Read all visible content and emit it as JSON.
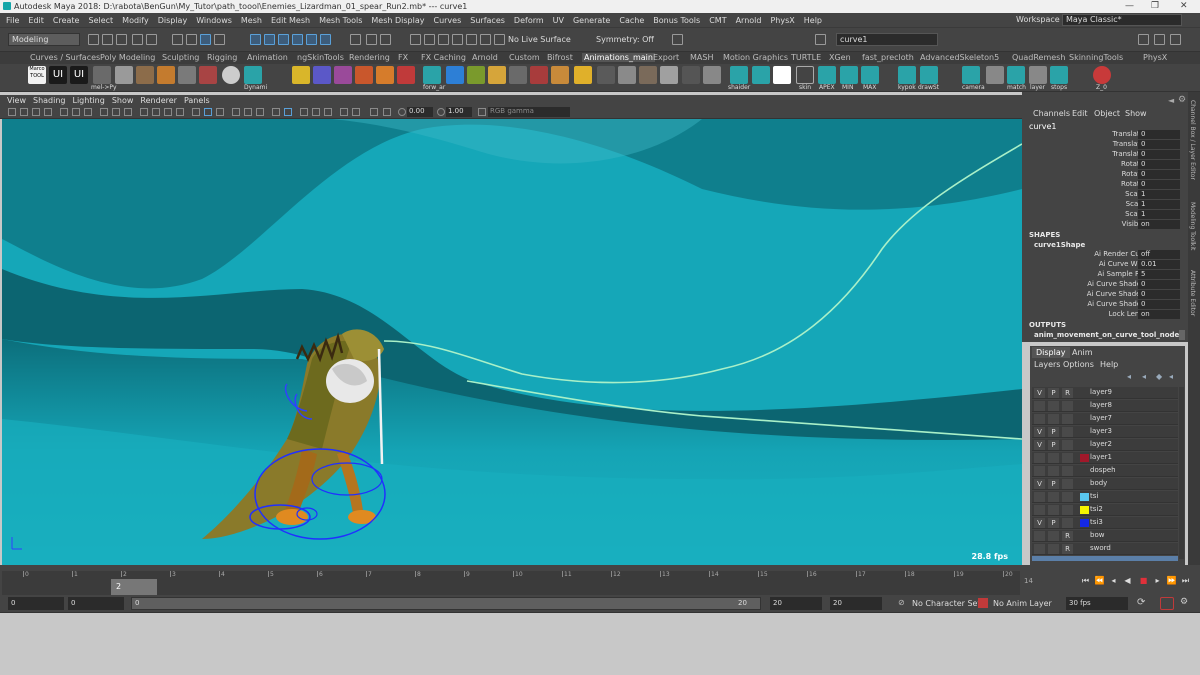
{
  "title_bar": {
    "text": "Autodesk Maya 2018: D:\\rabota\\BenGun\\My_Tutor\\path_toool\\Enemies_Lizardman_01_spear_Run2.mb*   ---   curve1"
  },
  "menu": [
    "File",
    "Edit",
    "Create",
    "Select",
    "Modify",
    "Display",
    "Windows",
    "Mesh",
    "Edit Mesh",
    "Mesh Tools",
    "Mesh Display",
    "Curves",
    "Surfaces",
    "Deform",
    "UV",
    "Generate",
    "Cache",
    "Bonus Tools",
    "CMT",
    "Arnold",
    "PhysX",
    "Help"
  ],
  "workspace": {
    "label": "Workspace :",
    "value": "Maya Classic*"
  },
  "status_line": {
    "mode": "Modeling",
    "live_surface": "No Live Surface",
    "symmetry": "Symmetry: Off",
    "object_name": "curve1"
  },
  "shelf_tabs": [
    "Curves / Surfaces",
    "Poly Modeling",
    "Sculpting",
    "Rigging",
    "Animation",
    "ngSkinTools",
    "Rendering",
    "FX",
    "FX Caching",
    "Arnold",
    "Custom",
    "Bifrost",
    "Animations_main",
    "Export",
    "MASH",
    "Motion Graphics",
    "TURTLE",
    "XGen",
    "fast_precloth",
    "AdvancedSkeleton5",
    "QuadRemesh",
    "SkinningTools",
    "PhysX"
  ],
  "active_shelf_tab": "Animations_main",
  "shelf_labels": {
    "marco": "Marco TOOL",
    "ui1": "UI",
    "ui2": "UI",
    "mel": "mel->Py",
    "dynami": "Dynami",
    "forw": "forw_ar",
    "shaider": "shaider",
    "skin": "skin",
    "apex": "APEX",
    "min": "MIN",
    "max": "MAX",
    "kypok": "kypok",
    "draw": "drawSt",
    "camera": "camera",
    "match": "match",
    "layer": "layer",
    "stops": "stops",
    "z": "Z_0"
  },
  "panel_menu": [
    "View",
    "Shading",
    "Lighting",
    "Show",
    "Renderer",
    "Panels"
  ],
  "panel_toolbar": {
    "exposure": "0.00",
    "gamma": "1.00",
    "colorspace": "RGB gamma"
  },
  "viewport": {
    "fps": "28.8 fps"
  },
  "channel_box": {
    "menu": [
      "Channels",
      "Edit",
      "Object",
      "Show"
    ],
    "object": "curve1",
    "transform": [
      {
        "name": "Translate X",
        "value": "0"
      },
      {
        "name": "Translate Y",
        "value": "0"
      },
      {
        "name": "Translate Z",
        "value": "0"
      },
      {
        "name": "Rotate X",
        "value": "0"
      },
      {
        "name": "Rotate Y",
        "value": "0"
      },
      {
        "name": "Rotate Z",
        "value": "0"
      },
      {
        "name": "Scale X",
        "value": "1"
      },
      {
        "name": "Scale Y",
        "value": "1"
      },
      {
        "name": "Scale Z",
        "value": "1"
      },
      {
        "name": "Visibility",
        "value": "on"
      }
    ],
    "shapes_label": "SHAPES",
    "shape_name": "curve1Shape",
    "shape_attrs": [
      {
        "name": "Ai Render Curve",
        "value": "off"
      },
      {
        "name": "Ai Curve Width",
        "value": "0.01"
      },
      {
        "name": "Ai Sample Rate",
        "value": "5"
      },
      {
        "name": "Ai Curve Shader R",
        "value": "0"
      },
      {
        "name": "Ai Curve Shader G",
        "value": "0"
      },
      {
        "name": "Ai Curve Shader B",
        "value": "0"
      },
      {
        "name": "Lock Length",
        "value": "on"
      }
    ],
    "outputs_label": "OUTPUTS",
    "output_name": "anim_movement_on_curve_tool_node"
  },
  "side_tabs": [
    "Channel Box / Layer Editor",
    "Modeling Toolkit",
    "Attribute Editor"
  ],
  "layer_editor": {
    "tabs": [
      "Display",
      "Anim"
    ],
    "menu": [
      "Layers",
      "Options",
      "Help"
    ],
    "layers": [
      {
        "v": "V",
        "p": "P",
        "r": "R",
        "name": "layer9",
        "color": ""
      },
      {
        "v": "",
        "p": "",
        "r": "",
        "name": "layer8",
        "color": ""
      },
      {
        "v": "",
        "p": "",
        "r": "",
        "name": "layer7",
        "color": ""
      },
      {
        "v": "V",
        "p": "P",
        "r": "",
        "name": "layer3",
        "color": ""
      },
      {
        "v": "V",
        "p": "P",
        "r": "",
        "name": "layer2",
        "color": ""
      },
      {
        "v": "",
        "p": "",
        "r": "",
        "name": "layer1",
        "color": "#a0182a"
      },
      {
        "v": "",
        "p": "",
        "r": "",
        "name": "dospeh",
        "color": ""
      },
      {
        "v": "V",
        "p": "P",
        "r": "",
        "name": "body",
        "color": ""
      },
      {
        "v": "",
        "p": "",
        "r": "",
        "name": "tsi",
        "color": "#5ac8f0"
      },
      {
        "v": "",
        "p": "",
        "r": "",
        "name": "tsi2",
        "color": "#f5f500"
      },
      {
        "v": "V",
        "p": "P",
        "r": "",
        "name": "tsi3",
        "color": "#1428e6"
      },
      {
        "v": "",
        "p": "",
        "r": "R",
        "name": "bow",
        "color": ""
      },
      {
        "v": "",
        "p": "",
        "r": "R",
        "name": "sword",
        "color": ""
      }
    ]
  },
  "timeline": {
    "ticks": [
      "0",
      "1",
      "2",
      "3",
      "4",
      "5",
      "6",
      "7",
      "8",
      "9",
      "10",
      "11",
      "12",
      "13",
      "14",
      "15",
      "16",
      "17",
      "18",
      "19",
      "20"
    ],
    "current_frame": "2",
    "end_frame": "14"
  },
  "range": {
    "start": "0",
    "anim_start": "0",
    "playback_end": "20",
    "range_end": "20",
    "anim_end": "20",
    "range_start_val": "0",
    "character_set": "No Character Set",
    "anim_layer": "No Anim Layer",
    "fps": "30 fps"
  }
}
